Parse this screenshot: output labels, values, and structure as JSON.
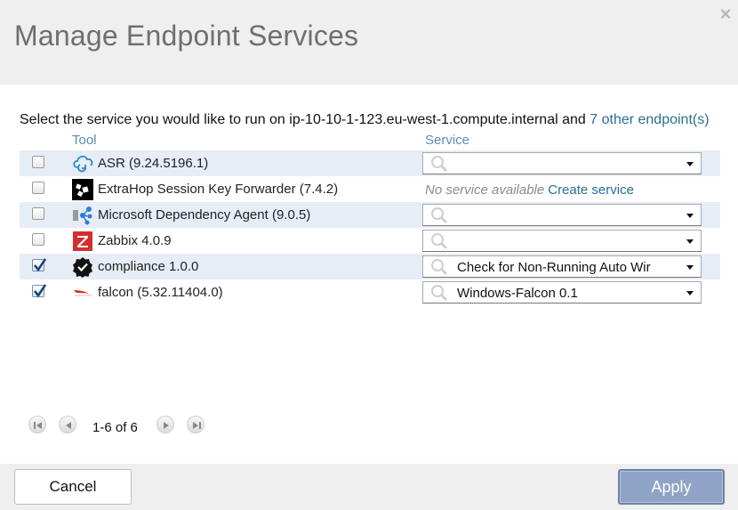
{
  "dialog": {
    "title": "Manage Endpoint Services",
    "close_glyph": "×",
    "prompt_text": "Select the service you would like to run on ip-10-10-1-123.eu-west-1.compute.internal and ",
    "prompt_link": "7 other endpoint(s)"
  },
  "columns": {
    "tool": "Tool",
    "service": "Service"
  },
  "rows": [
    {
      "checked": false,
      "icon": "asr-cloud-icon",
      "label": "ASR (9.24.5196.1)",
      "service": ""
    },
    {
      "checked": false,
      "icon": "extrahop-icon",
      "label": "ExtraHop Session Key Forwarder (7.4.2)",
      "no_service_text": "No service available",
      "create_link": "Create service"
    },
    {
      "checked": false,
      "icon": "microsoft-dependency-icon",
      "label": "Microsoft Dependency Agent (9.0.5)",
      "service": ""
    },
    {
      "checked": false,
      "icon": "zabbix-icon",
      "label": "Zabbix 4.0.9",
      "service": ""
    },
    {
      "checked": true,
      "icon": "compliance-badge-icon",
      "label": "compliance 1.0.0",
      "service": "Check for Non-Running Auto Wir"
    },
    {
      "checked": true,
      "icon": "falcon-icon",
      "label": "falcon (5.32.11404.0)",
      "service": "Windows-Falcon 0.1"
    }
  ],
  "pager": {
    "text": "1-6 of 6"
  },
  "footer": {
    "cancel_label": "Cancel",
    "apply_label": "Apply"
  },
  "colors": {
    "header_bg": "#efefef",
    "row_alt": "#e6edf6",
    "link": "#2a6f8f",
    "column_header": "#5b8db0",
    "apply_bg": "#8ea3c5"
  }
}
